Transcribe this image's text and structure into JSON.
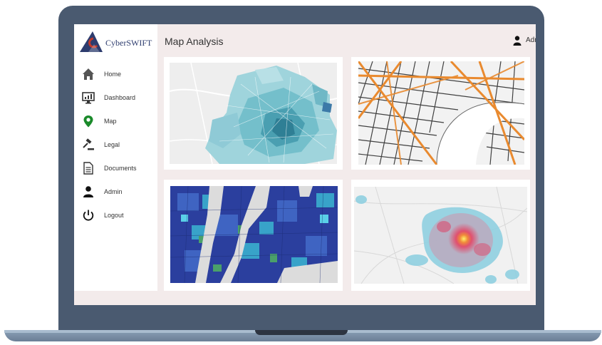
{
  "app": {
    "brand": "CyberSWIFT",
    "page_title": "Map Analysis",
    "brand_colors": {
      "navy": "#2d3c6e",
      "red": "#c0392b"
    }
  },
  "header": {
    "user_label": "Admin",
    "user_icon": "user-icon"
  },
  "sidebar": {
    "items": [
      {
        "label": "Home",
        "icon": "home-icon"
      },
      {
        "label": "Dashboard",
        "icon": "dashboard-icon"
      },
      {
        "label": "Map",
        "icon": "map-pin-icon"
      },
      {
        "label": "Legal",
        "icon": "gavel-icon"
      },
      {
        "label": "Documents",
        "icon": "document-icon"
      },
      {
        "label": "Admin",
        "icon": "user-icon"
      },
      {
        "label": "Logout",
        "icon": "power-icon"
      }
    ]
  },
  "panels": [
    {
      "kind": "choropleth-teal",
      "accent": "#5fb3c4"
    },
    {
      "kind": "street-network-orange",
      "accent": "#e98a2f"
    },
    {
      "kind": "choropleth-blue",
      "accent": "#2d4aa8"
    },
    {
      "kind": "heatmap",
      "accent": "#e64a6b"
    }
  ]
}
